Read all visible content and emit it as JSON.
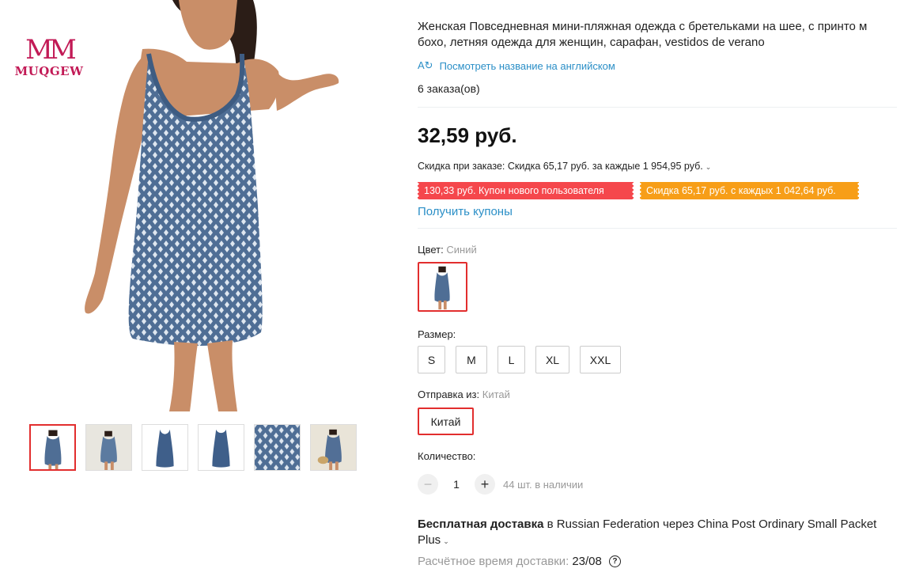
{
  "brand": {
    "logo_mark": "MM",
    "logo_text": "MUQGEW"
  },
  "gallery": {
    "thumbnails": [
      {
        "name": "thumb-front-model",
        "active": true
      },
      {
        "name": "thumb-beach-model",
        "active": false
      },
      {
        "name": "thumb-dress-flat-front",
        "active": false
      },
      {
        "name": "thumb-dress-flat-back",
        "active": false
      },
      {
        "name": "thumb-fabric-closeup",
        "active": false
      },
      {
        "name": "thumb-model-with-hat",
        "active": false
      }
    ]
  },
  "product": {
    "title": "Женская Повседневная мини-пляжная одежда с бретельками на шее, с принто м бохо, летняя одежда для женщин, сарафан, vestidos de verano",
    "translate_icon": "translate-icon",
    "translate_link": "Посмотреть название на английском",
    "orders": "6 заказа(ов)",
    "price": "32,59 руб."
  },
  "discount": {
    "text": "Скидка при заказе: Скидка 65,17 руб. за каждые 1 954,95 руб.",
    "coupons": [
      {
        "label": "130,33 руб. Купон нового пользователя",
        "color": "#f5474c"
      },
      {
        "label": "Скидка 65,17 руб. с каждых 1 042,64 руб.",
        "color": "#f79e18"
      }
    ],
    "get_coupons": "Получить купоны"
  },
  "color": {
    "label": "Цвет:",
    "value": "Синий"
  },
  "size": {
    "label": "Размер:",
    "options": [
      "S",
      "M",
      "L",
      "XL",
      "XXL"
    ]
  },
  "ship_from": {
    "label": "Отправка из:",
    "value": "Китай",
    "option": "Китай"
  },
  "quantity": {
    "label": "Количество:",
    "value": "1",
    "minus": "−",
    "plus": "+",
    "stock": "44 шт. в наличии"
  },
  "shipping": {
    "free": "Бесплатная доставка",
    "details": "в Russian Federation через China Post Ordinary Small Packet Plus",
    "eta_label": "Расчётное время доставки:",
    "eta_date": "23/08",
    "help_icon": "question-circle-icon"
  },
  "colors": {
    "accent_red": "#e22e2e",
    "link_blue": "#2b8fc7",
    "brand_pink": "#c21a56",
    "coupon_red": "#f5474c",
    "coupon_orange": "#f79e18"
  }
}
